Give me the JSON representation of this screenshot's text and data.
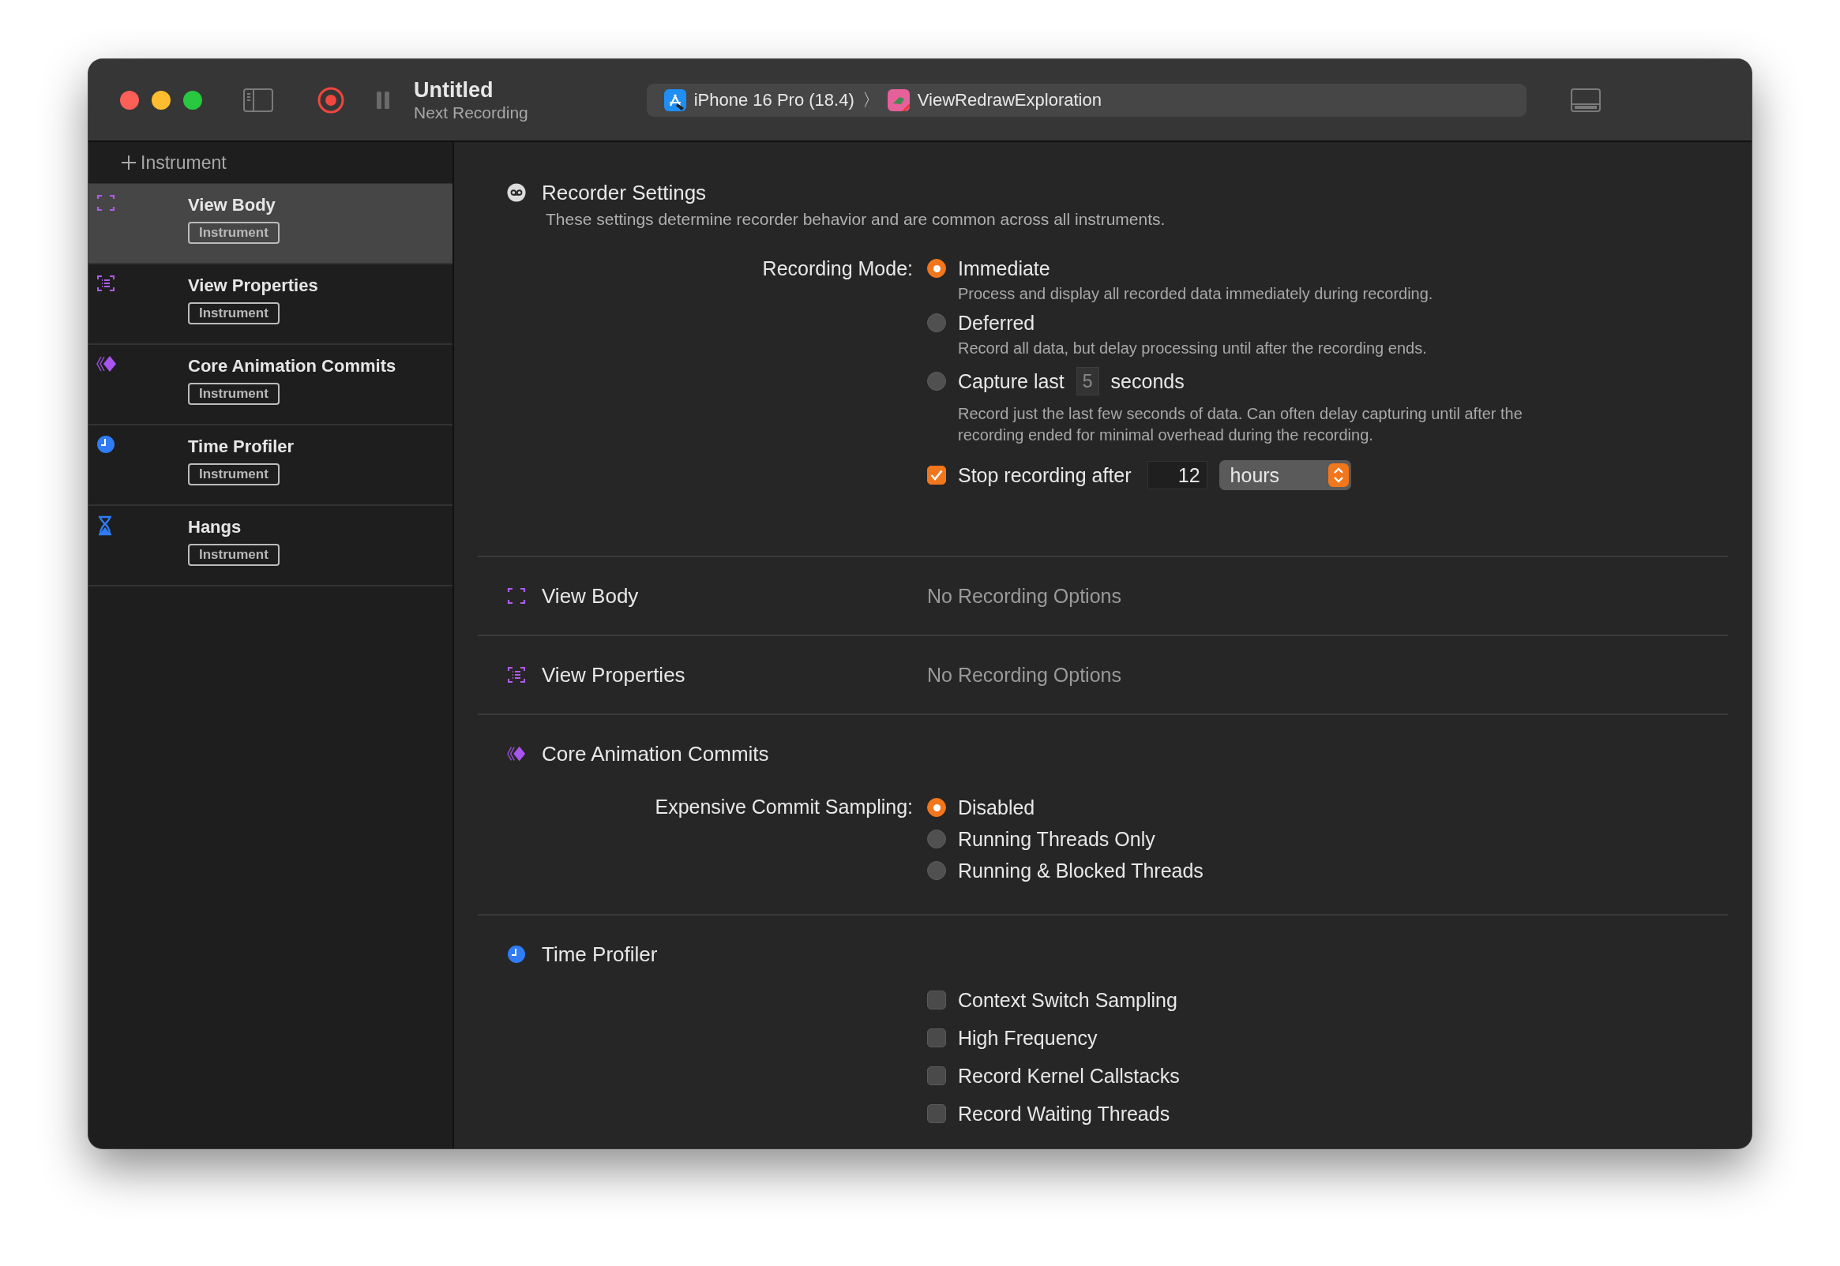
{
  "window": {
    "title": "Untitled",
    "subtitle": "Next Recording"
  },
  "scheme": {
    "device": "iPhone 16 Pro (18.4)",
    "separator": "〉",
    "target": "ViewRedrawExploration"
  },
  "sidebar": {
    "add_label": "Instrument",
    "items": [
      {
        "name": "View Body",
        "tag": "Instrument",
        "selected": true
      },
      {
        "name": "View Properties",
        "tag": "Instrument",
        "selected": false
      },
      {
        "name": "Core Animation Commits",
        "tag": "Instrument",
        "selected": false
      },
      {
        "name": "Time Profiler",
        "tag": "Instrument",
        "selected": false
      },
      {
        "name": "Hangs",
        "tag": "Instrument",
        "selected": false
      }
    ]
  },
  "recorder": {
    "title": "Recorder Settings",
    "description": "These settings determine recorder behavior and are common across all instruments.",
    "recording_mode": {
      "label": "Recording Mode:",
      "options": [
        {
          "kind": "plain",
          "label": "Immediate",
          "description": "Process and display all recorded data immediately during recording.",
          "selected": true
        },
        {
          "kind": "plain",
          "label": "Deferred",
          "description": "Record all data, but delay processing until after the recording ends.",
          "selected": false
        },
        {
          "kind": "capture",
          "label": "Capture last",
          "value": "5",
          "suffix": "seconds",
          "description": "Record just the last few seconds of data. Can often delay capturing until after the recording ended for minimal overhead during the recording.",
          "selected": false
        }
      ]
    },
    "stop_after": {
      "label": "Stop recording after",
      "checked": true,
      "value": "12",
      "unit": "hours"
    }
  },
  "instrument_sections": [
    {
      "kind": "none",
      "title": "View Body",
      "value": "No Recording Options"
    },
    {
      "kind": "none",
      "title": "View Properties",
      "value": "No Recording Options"
    },
    {
      "kind": "radio",
      "title": "Core Animation Commits",
      "label": "Expensive Commit Sampling:",
      "options": [
        {
          "label": "Disabled",
          "selected": true
        },
        {
          "label": "Running Threads Only",
          "selected": false
        },
        {
          "label": "Running & Blocked Threads",
          "selected": false
        }
      ]
    },
    {
      "kind": "checkboxes",
      "title": "Time Profiler",
      "options": [
        {
          "label": "Context Switch Sampling",
          "checked": false
        },
        {
          "label": "High Frequency",
          "checked": false
        },
        {
          "label": "Record Kernel Callstacks",
          "checked": false
        },
        {
          "label": "Record Waiting Threads",
          "checked": false
        }
      ]
    }
  ]
}
